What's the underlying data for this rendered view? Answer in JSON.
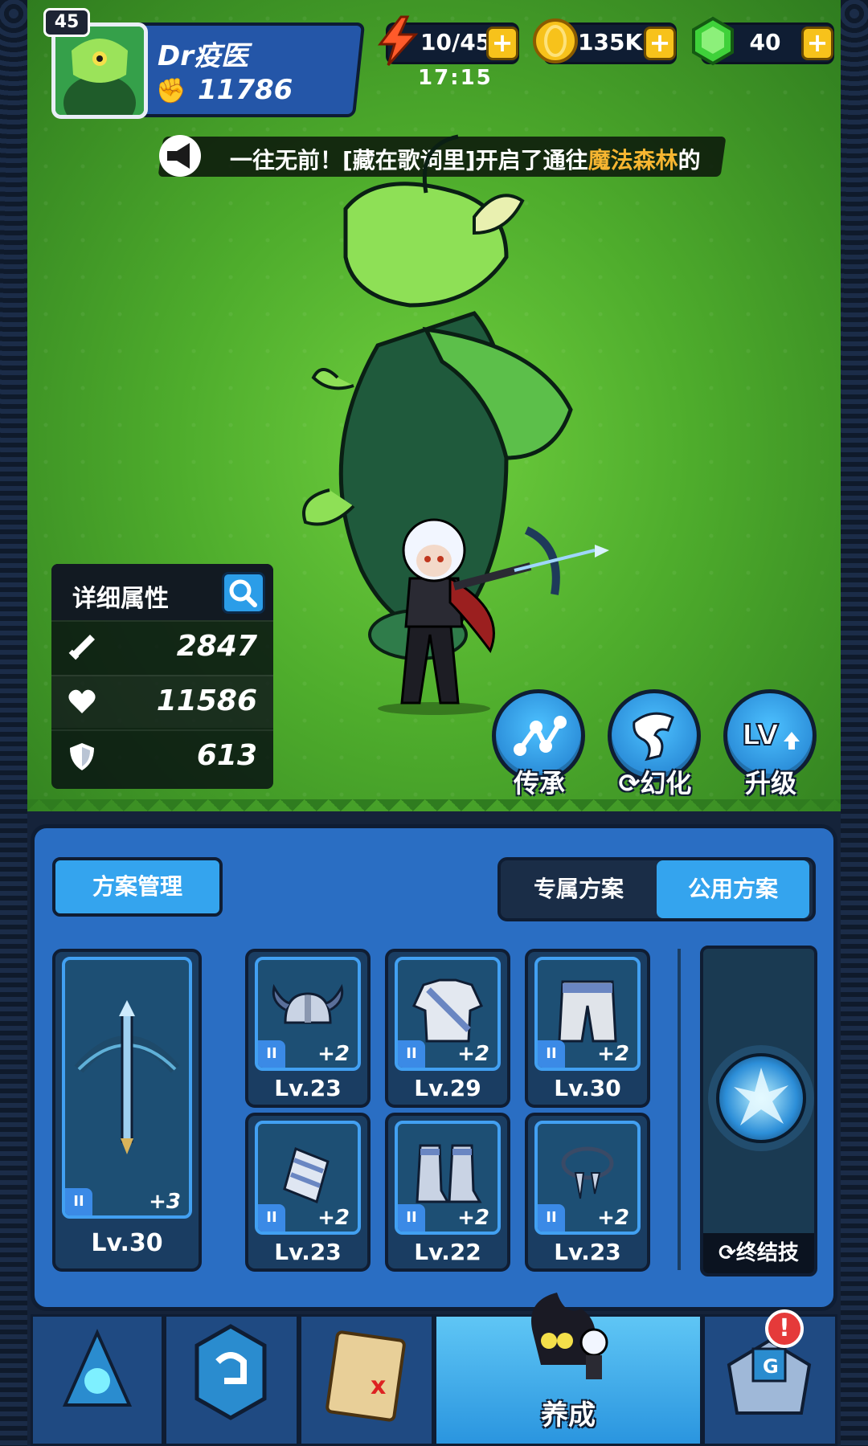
{
  "player": {
    "level": "45",
    "name": "Dr疫医",
    "power": "11786"
  },
  "resources": {
    "energy": "10/45",
    "energy_timer": "17:15",
    "gold": "135K",
    "gems": "40",
    "plus": "+"
  },
  "broadcast": {
    "prefix": "一往无前！[藏在歌词里]开启了通往",
    "highlight": "魔法森林",
    "suffix": "的"
  },
  "stats": {
    "title": "详细属性",
    "attack": "2847",
    "health": "11586",
    "defense": "613"
  },
  "actions": {
    "inherit": "传承",
    "transform": "幻化",
    "upgrade": "升级"
  },
  "panel": {
    "plan_button": "方案管理",
    "tab_exclusive": "专属方案",
    "tab_public": "公用方案",
    "ultimate_label": "终结技"
  },
  "equipment": [
    {
      "slot": "weapon",
      "tier": "II",
      "plus": "+3",
      "level": "Lv.30"
    },
    {
      "slot": "helmet",
      "tier": "II",
      "plus": "+2",
      "level": "Lv.23"
    },
    {
      "slot": "armor",
      "tier": "II",
      "plus": "+2",
      "level": "Lv.29"
    },
    {
      "slot": "pants",
      "tier": "II",
      "plus": "+2",
      "level": "Lv.30"
    },
    {
      "slot": "gloves",
      "tier": "II",
      "plus": "+2",
      "level": "Lv.23"
    },
    {
      "slot": "boots",
      "tier": "II",
      "plus": "+2",
      "level": "Lv.22"
    },
    {
      "slot": "necklace",
      "tier": "II",
      "plus": "+2",
      "level": "Lv.23"
    }
  ],
  "nav": {
    "active_label": "养成",
    "notification": "!"
  },
  "colors": {
    "accent": "#34a4ee",
    "highlight": "#f6b531",
    "panel": "#2a6ec3",
    "scene": "#4eac2c"
  }
}
